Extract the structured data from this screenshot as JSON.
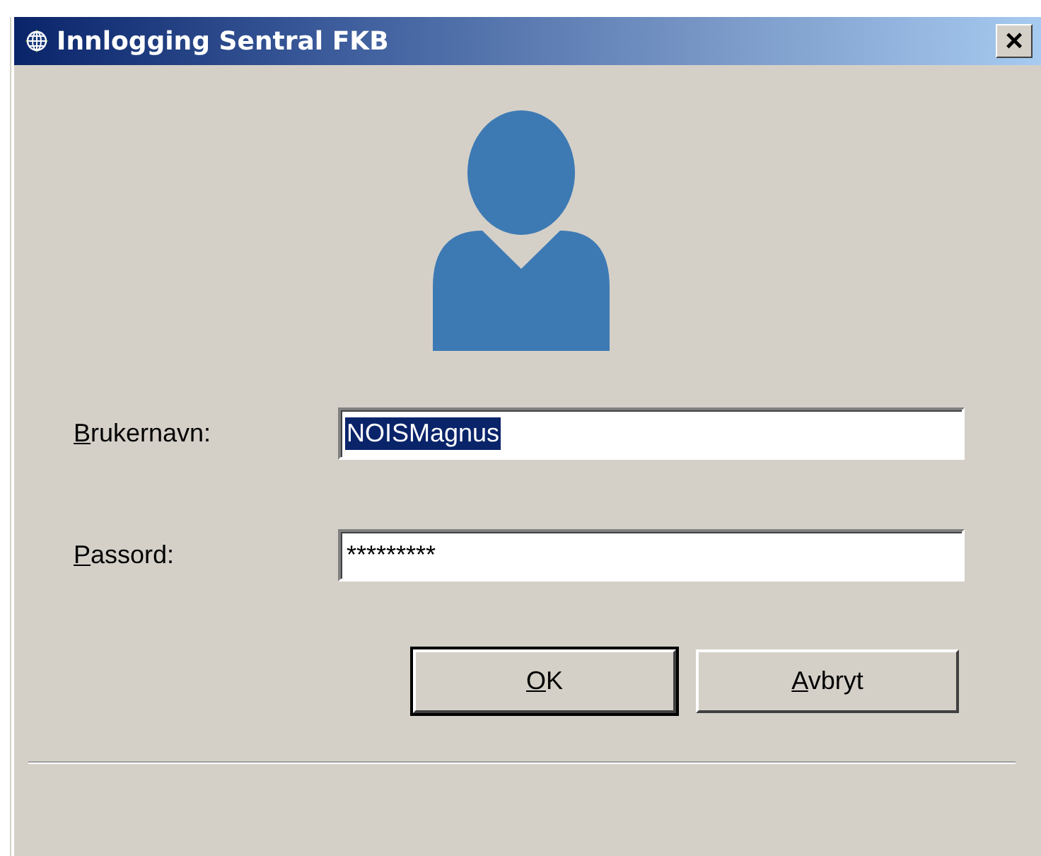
{
  "window": {
    "title": "Innlogging Sentral FKB",
    "close_label": "×"
  },
  "fields": [
    {
      "label": "Brukernavn:",
      "value": "NOISMagnus",
      "text_selected": true
    },
    {
      "label": "Passord:",
      "value": "*********",
      "text_selected": false
    }
  ],
  "buttons": [
    {
      "label": "OK",
      "default": true
    },
    {
      "label": "Avbryt",
      "default": false
    }
  ]
}
